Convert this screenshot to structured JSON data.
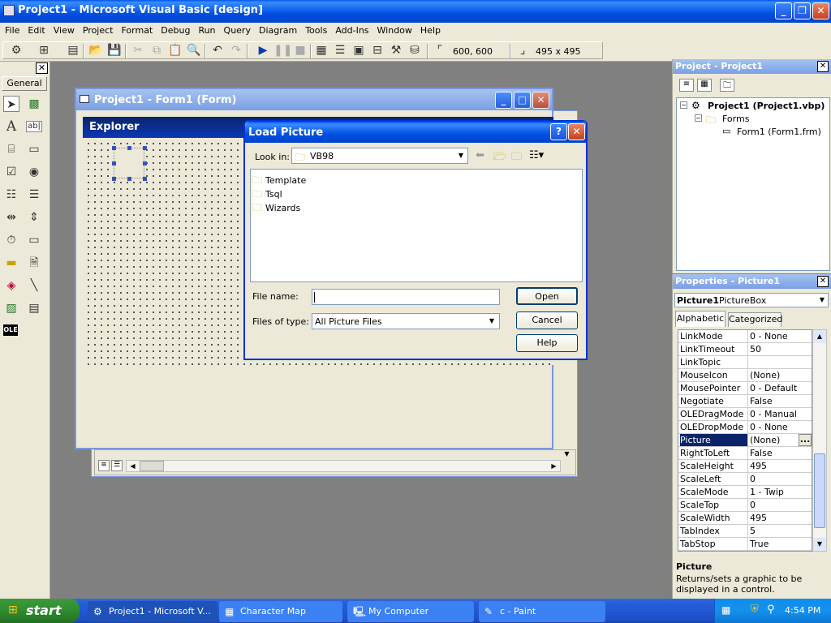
{
  "window": {
    "title": "Project1 - Microsoft Visual Basic [design]"
  },
  "menu": [
    "File",
    "Edit",
    "View",
    "Project",
    "Format",
    "Debug",
    "Run",
    "Query",
    "Diagram",
    "Tools",
    "Add-Ins",
    "Window",
    "Help"
  ],
  "toolbar": {
    "position": "600, 600",
    "size": "495 x 495"
  },
  "toolbox": {
    "tab_label": "General"
  },
  "form_window": {
    "title": "Project1 - Form1 (Form)",
    "form_caption": "Explorer"
  },
  "dialog": {
    "title": "Load Picture",
    "look_in_label": "Look in:",
    "look_in_value": "VB98",
    "folders": [
      "Template",
      "Tsql",
      "Wizards"
    ],
    "file_name_label": "File name:",
    "file_name_value": "",
    "files_of_type_label": "Files of type:",
    "files_of_type_value": "All Picture Files",
    "open_label": "Open",
    "cancel_label": "Cancel",
    "help_label": "Help"
  },
  "project_panel": {
    "title": "Project - Project1",
    "root": "Project1 (Project1.vbp)",
    "folder": "Forms",
    "file": "Form1 (Form1.frm)"
  },
  "properties_panel": {
    "title": "Properties - Picture1",
    "object_name": "Picture1",
    "object_type": "PictureBox",
    "tab_alpha": "Alphabetic",
    "tab_cat": "Categorized",
    "rows": [
      {
        "name": "LinkMode",
        "value": "0 - None"
      },
      {
        "name": "LinkTimeout",
        "value": "50"
      },
      {
        "name": "LinkTopic",
        "value": ""
      },
      {
        "name": "MouseIcon",
        "value": "(None)"
      },
      {
        "name": "MousePointer",
        "value": "0 - Default"
      },
      {
        "name": "Negotiate",
        "value": "False"
      },
      {
        "name": "OLEDragMode",
        "value": "0 - Manual"
      },
      {
        "name": "OLEDropMode",
        "value": "0 - None"
      },
      {
        "name": "Picture",
        "value": "(None)"
      },
      {
        "name": "RightToLeft",
        "value": "False"
      },
      {
        "name": "ScaleHeight",
        "value": "495"
      },
      {
        "name": "ScaleLeft",
        "value": "0"
      },
      {
        "name": "ScaleMode",
        "value": "1 - Twip"
      },
      {
        "name": "ScaleTop",
        "value": "0"
      },
      {
        "name": "ScaleWidth",
        "value": "495"
      },
      {
        "name": "TabIndex",
        "value": "5"
      },
      {
        "name": "TabStop",
        "value": "True"
      }
    ],
    "selected_row": "Picture",
    "description_title": "Picture",
    "description_text": "Returns/sets a graphic to be displayed in a control."
  },
  "taskbar": {
    "start_label": "start",
    "items": [
      "Project1 - Microsoft V...",
      "Character Map",
      "My Computer",
      "c - Paint"
    ],
    "clock": "4:54 PM"
  },
  "colors": {
    "xp_blue": "#0a246a",
    "title_active": "#0054e3",
    "face": "#ece9d8",
    "selected": "#0a246a"
  }
}
